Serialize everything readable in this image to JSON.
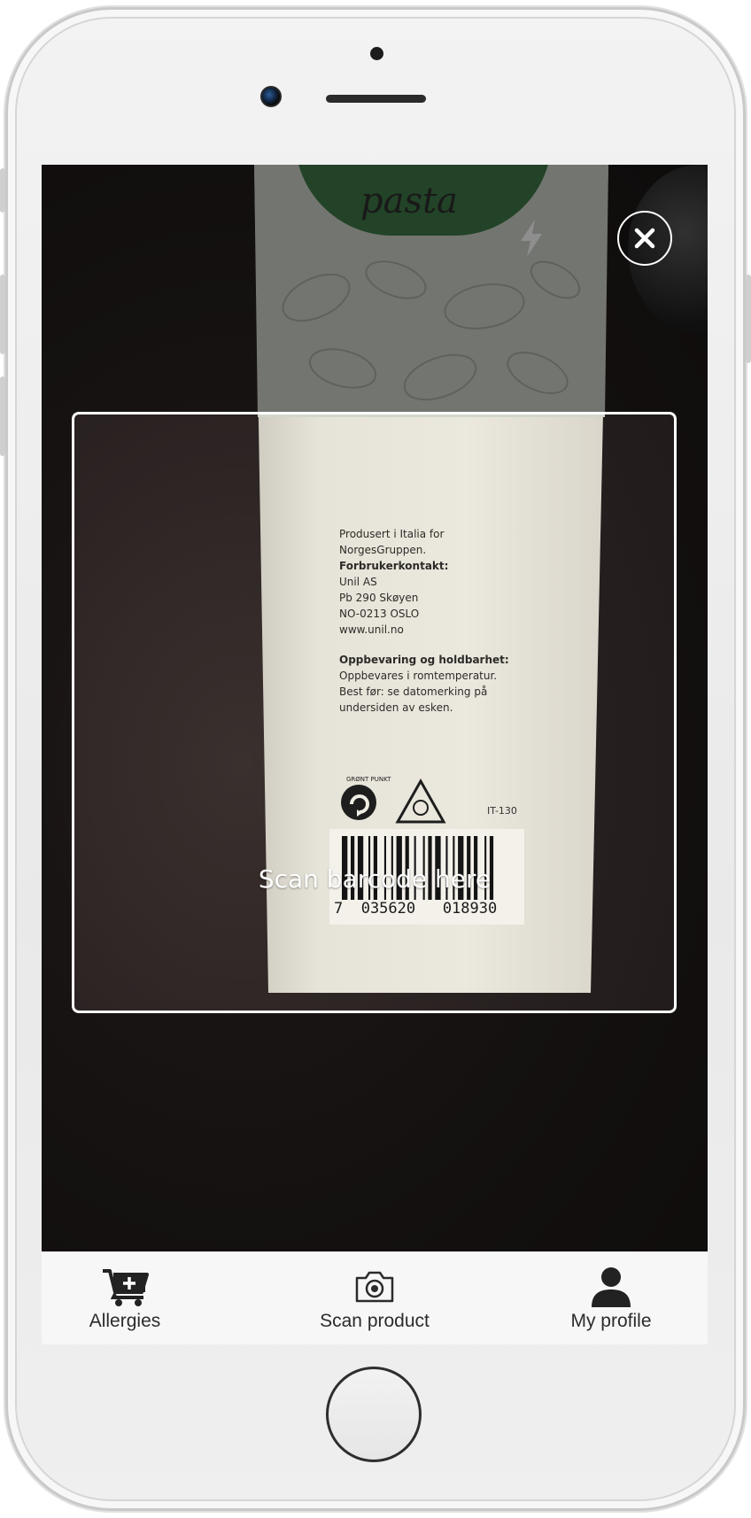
{
  "camera": {
    "scan_hint": "Scan barcode here",
    "flash_icon": "lightning-bolt-icon",
    "close_icon": "close-x-icon"
  },
  "product_packaging": {
    "brand_text": "pasta",
    "print_lines": [
      {
        "text": "Produsert i Italia for",
        "bold": false
      },
      {
        "text": "NorgesGruppen.",
        "bold": false
      },
      {
        "text": "Forbrukerkontakt:",
        "bold": true
      },
      {
        "text": "Unil AS",
        "bold": false
      },
      {
        "text": "Pb 290 Skøyen",
        "bold": false
      },
      {
        "text": "NO-0213 OSLO",
        "bold": false
      },
      {
        "text": "www.unil.no",
        "bold": false
      },
      {
        "text": "",
        "bold": false
      },
      {
        "text": "Oppbevaring og holdbarhet:",
        "bold": true
      },
      {
        "text": "Oppbevares i romtemperatur.",
        "bold": false
      },
      {
        "text": "Best før: se datomerking på",
        "bold": false
      },
      {
        "text": "undersiden av esken.",
        "bold": false
      }
    ],
    "recycle_mark_text": "GRØNT PUNKT",
    "item_code": "IT-130",
    "barcode_number": "7  035620   018930"
  },
  "tabbar": {
    "tabs": [
      {
        "label": "Allergies",
        "icon": "cart-plus-icon"
      },
      {
        "label": "Scan product",
        "icon": "camera-icon"
      },
      {
        "label": "My profile",
        "icon": "person-icon"
      }
    ]
  },
  "colors": {
    "tabbar_bg": "#f7f7f7",
    "scan_frame": "#ffffff",
    "viewfinder_bg": "#2b2727"
  }
}
